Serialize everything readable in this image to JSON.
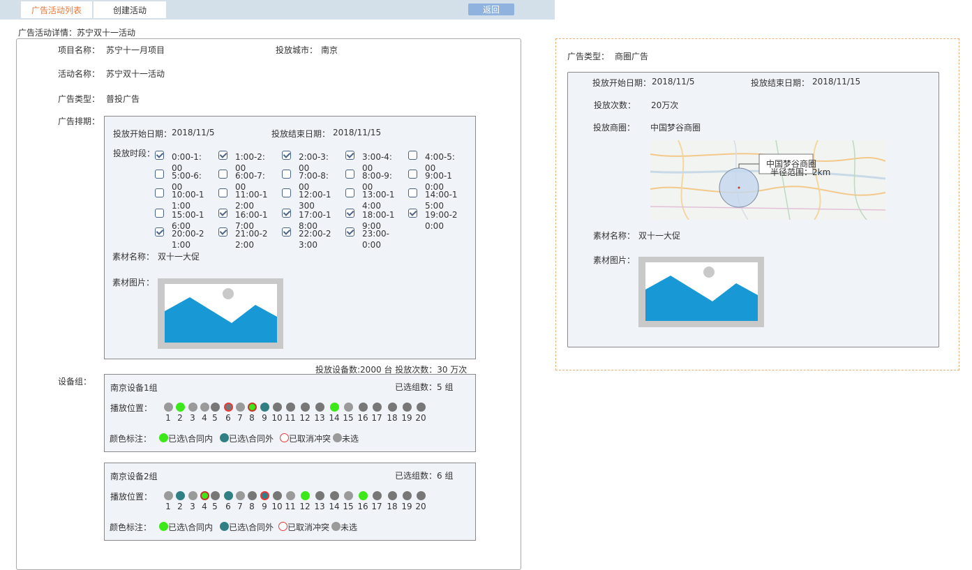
{
  "tabs": [
    "广告活动列表",
    "创建活动"
  ],
  "back_label": "返回",
  "detail_title": "广告活动详情：苏宁双十一活动",
  "main": {
    "project_label": "项目名称：",
    "project_value": "苏宁十一月项目",
    "city_label": "投放城市：",
    "city_value": "南京",
    "activity_label": "活动名称：",
    "activity_value": "苏宁双十一活动",
    "adtype_label": "广告类型：",
    "adtype_value": "普投广告",
    "schedule_label": "广告排期：",
    "start_label": "投放开始日期：",
    "start_value": "2018/11/5",
    "end_label": "投放结束日期：",
    "end_value": "2018/11/15",
    "slots_label": "投放时段：",
    "slots": [
      {
        "text": "0:00-1:00",
        "checked": true
      },
      {
        "text": "1:00-2:00",
        "checked": true
      },
      {
        "text": "2:00-3:00",
        "checked": true
      },
      {
        "text": "3:00-4:00",
        "checked": true
      },
      {
        "text": "4:00-5:00",
        "checked": false
      },
      {
        "text": "5:00-6:00",
        "checked": false
      },
      {
        "text": "6:00-7:00",
        "checked": false
      },
      {
        "text": "7:00-8:00",
        "checked": false
      },
      {
        "text": "8:00-9:00",
        "checked": false
      },
      {
        "text": "9:00-10:00",
        "checked": false
      },
      {
        "text": "10:00-11:00",
        "checked": false
      },
      {
        "text": "11:00-12:00",
        "checked": false
      },
      {
        "text": "12:00-1300",
        "checked": false
      },
      {
        "text": "13:00-14:00",
        "checked": false
      },
      {
        "text": "14:00-15:00",
        "checked": false
      },
      {
        "text": "15:00-16:00",
        "checked": false
      },
      {
        "text": "16:00-17:00",
        "checked": true
      },
      {
        "text": "17:00-18:00",
        "checked": true
      },
      {
        "text": "18:00-19:00",
        "checked": true
      },
      {
        "text": "19:00-20:00",
        "checked": true
      },
      {
        "text": "20:00-21:00",
        "checked": true
      },
      {
        "text": "21:00-22:00",
        "checked": true
      },
      {
        "text": "22:00-23:00",
        "checked": true
      },
      {
        "text": "23:00-0:00",
        "checked": true
      }
    ],
    "material_name_label": "素材名称：",
    "material_name_value": "双十一大促",
    "material_img_label": "素材图片：",
    "summary": "投放设备数:2000 台    投放次数：30 万次",
    "device_label": "设备组：",
    "groups": [
      {
        "name": "南京设备1组",
        "selected": "已选组数：5    组",
        "pos_label": "播放位置：",
        "states": [
          "grey",
          "green",
          "grey",
          "grey",
          "dgrey",
          "red-ring",
          "grey",
          "redgreen",
          "teal",
          "dgrey",
          "dgrey",
          "dgrey",
          "dgrey",
          "green",
          "grey",
          "dgrey",
          "dgrey",
          "dgrey",
          "dgrey",
          "dgrey"
        ],
        "legend_label": "颜色标注：",
        "legend": [
          "已选\\合同内",
          "已选\\合同外",
          "已取消冲突",
          "未选"
        ]
      },
      {
        "name": "南京设备2组",
        "selected": "已选组数：6    组",
        "pos_label": "播放位置：",
        "states": [
          "grey",
          "teal",
          "grey",
          "redgreen",
          "dgrey",
          "teal",
          "grey",
          "dgrey",
          "tealred",
          "dgrey",
          "grey",
          "green",
          "dgrey",
          "dgrey",
          "grey",
          "green",
          "dgrey",
          "dgrey",
          "dgrey",
          "dgrey"
        ],
        "legend_label": "颜色标注：",
        "legend": [
          "已选\\合同内",
          "已选\\合同外",
          "已取消冲突",
          "未选"
        ]
      }
    ],
    "numbers": [
      "1",
      "2",
      "3",
      "4",
      "5",
      "6",
      "7",
      "8",
      "9",
      "10",
      "11",
      "12",
      "13",
      "14",
      "15",
      "16",
      "17",
      "18",
      "19",
      "20"
    ]
  },
  "right": {
    "adtype_label": "广告类型：",
    "adtype_value": "商圈广告",
    "start_label": "投放开始日期：",
    "start_value": "2018/11/5",
    "end_label": "投放结束日期：",
    "end_value": "2018/11/15",
    "count_label": "投放次数：",
    "count_value": "20万次",
    "area_label": "投放商圈：",
    "area_value": "中国梦谷商圈",
    "map_popup_title": "中国梦谷商圈",
    "map_popup_radius": "半径范围：2km",
    "material_name_label": "素材名称：",
    "material_name_value": "双十一大促",
    "material_img_label": "素材图片："
  }
}
